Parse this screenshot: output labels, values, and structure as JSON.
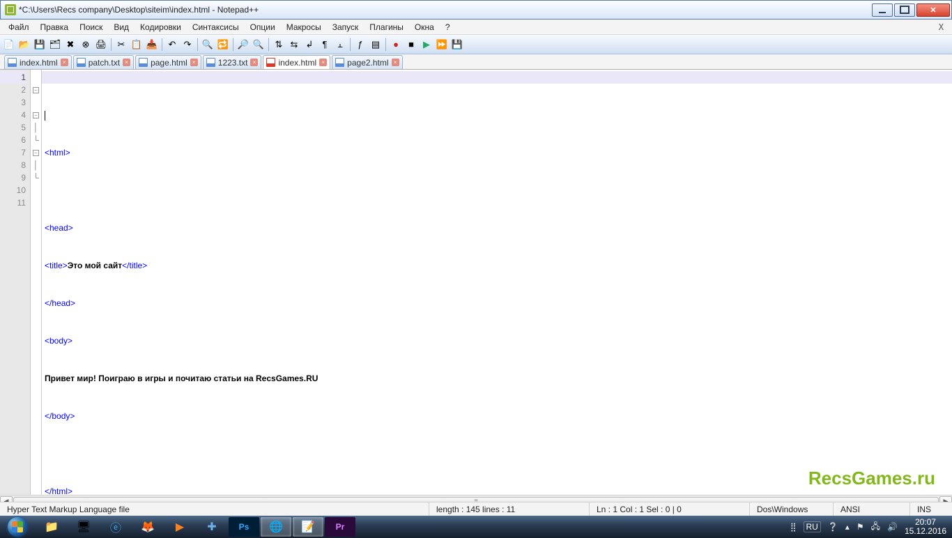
{
  "window": {
    "title": "*C:\\Users\\Recs company\\Desktop\\siteim\\index.html - Notepad++"
  },
  "menu": [
    "Файл",
    "Правка",
    "Поиск",
    "Вид",
    "Кодировки",
    "Синтаксисы",
    "Опции",
    "Макросы",
    "Запуск",
    "Плагины",
    "Окна",
    "?"
  ],
  "menu_close": "X",
  "tabs": [
    {
      "label": "index.html",
      "active": false
    },
    {
      "label": "patch.txt",
      "active": false
    },
    {
      "label": "page.html",
      "active": false
    },
    {
      "label": "1223.txt",
      "active": false
    },
    {
      "label": "index.html",
      "active": true
    },
    {
      "label": "page2.html",
      "active": false
    }
  ],
  "code": {
    "lines": [
      "1",
      "2",
      "3",
      "4",
      "5",
      "6",
      "7",
      "8",
      "9",
      "10",
      "11"
    ],
    "l1": "",
    "l2_tag": "<html>",
    "l3": "",
    "l4_tag": "<head>",
    "l5_open": "<title>",
    "l5_text": "Это мой сайт",
    "l5_close": "</title>",
    "l6_tag": "</head>",
    "l7_tag": "<body>",
    "l8_text": "Привет мир! Поиграю в игры и почитаю статьи на RecsGames.RU",
    "l9_tag": "</body>",
    "l10": "",
    "l11_tag": "</html>"
  },
  "status": {
    "filetype": "Hyper Text Markup Language file",
    "length": "length : 145    lines : 11",
    "pos": "Ln : 1    Col : 1    Sel : 0 | 0",
    "eol": "Dos\\Windows",
    "enc": "ANSI",
    "mode": "INS"
  },
  "watermark": "RecsGames.ru",
  "tray": {
    "lang": "RU",
    "time": "20:07",
    "date": "15.12.2016"
  }
}
